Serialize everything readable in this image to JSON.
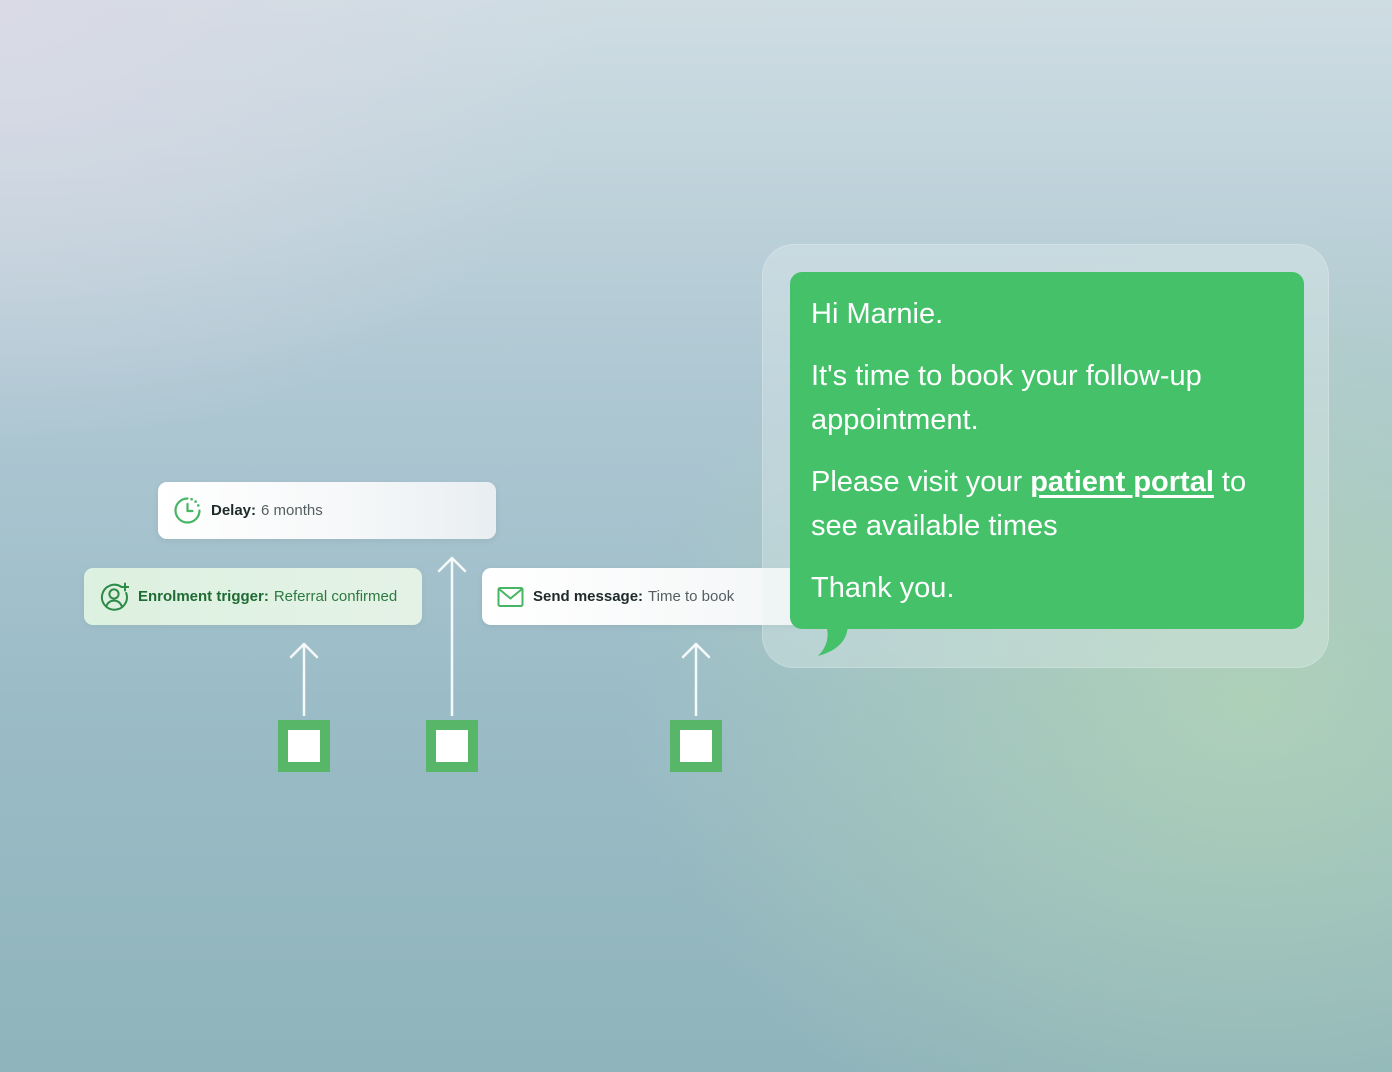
{
  "steps": {
    "delay": {
      "label": "Delay:",
      "value": "6 months",
      "icon": "clock-icon"
    },
    "trigger": {
      "label": "Enrolment trigger:",
      "value": "Referral confirmed",
      "icon": "user-add-icon"
    },
    "message": {
      "label": "Send message:",
      "value": "Time to book",
      "icon": "envelope-icon"
    }
  },
  "message_bubble": {
    "greeting": "Hi Marnie.",
    "line1": "It's time to book your follow-up appointment.",
    "line2_prefix": "Please visit your ",
    "link_text": "patient portal",
    "line2_suffix": " to see available times",
    "closing": "Thank you."
  },
  "colors": {
    "accent_green": "#45c16a",
    "marker_green": "#58b668",
    "trigger_bg": "#ddf1e0",
    "dark_green_text": "#1e6b33"
  }
}
